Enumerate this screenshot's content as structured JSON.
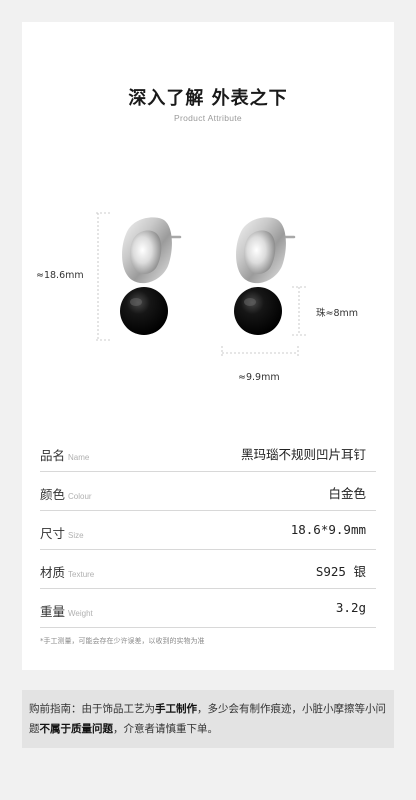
{
  "header": {
    "title": "深入了解 外表之下",
    "subtitle": "Product Attribute"
  },
  "dimensions": {
    "height": "≈18.6mm",
    "bead": "珠≈8mm",
    "width": "≈9.9mm"
  },
  "specs": [
    {
      "label": "品名",
      "label_en": "Name",
      "value": "黑玛瑙不规则凹片耳钉"
    },
    {
      "label": "颜色",
      "label_en": "Colour",
      "value": "白金色"
    },
    {
      "label": "尺寸",
      "label_en": "Size",
      "value": "18.6*9.9mm"
    },
    {
      "label": "材质",
      "label_en": "Texture",
      "value": "S925 银"
    },
    {
      "label": "重量",
      "label_en": "Weight",
      "value": "3.2g"
    }
  ],
  "footnote": "*手工测量，可能会存在少许误差，以收到的实物为准",
  "notice": {
    "prefix": "购前指南：由于饰品工艺为",
    "bold1": "手工制作",
    "mid": "，多少会有制作痕迹，小脏小摩擦等小问题",
    "bold2": "不属于质量问题",
    "suffix": "，介意者请慎重下单。"
  }
}
